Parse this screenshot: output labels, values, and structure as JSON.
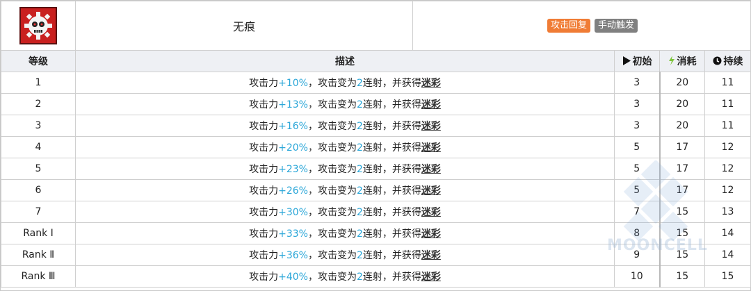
{
  "skill": {
    "name": "无痕",
    "icon": "skull-cog-icon",
    "tags": [
      {
        "label": "攻击回复",
        "color": "#f07c35"
      },
      {
        "label": "手动触发",
        "color": "#808080"
      }
    ]
  },
  "columns": {
    "level": "等级",
    "desc": "描述",
    "init": "初始",
    "cost": "消耗",
    "duration": "持续"
  },
  "desc_parts": {
    "prefix": "攻击力",
    "mid": "，攻击变为",
    "count": "2",
    "suffix": "连射，并获得",
    "keyword": "迷彩"
  },
  "rows": [
    {
      "level": "1",
      "bonus": "+10%",
      "init": "3",
      "cost": "20",
      "duration": "11"
    },
    {
      "level": "2",
      "bonus": "+13%",
      "init": "3",
      "cost": "20",
      "duration": "11"
    },
    {
      "level": "3",
      "bonus": "+16%",
      "init": "3",
      "cost": "20",
      "duration": "11"
    },
    {
      "level": "4",
      "bonus": "+20%",
      "init": "5",
      "cost": "17",
      "duration": "12"
    },
    {
      "level": "5",
      "bonus": "+23%",
      "init": "5",
      "cost": "17",
      "duration": "12"
    },
    {
      "level": "6",
      "bonus": "+26%",
      "init": "5",
      "cost": "17",
      "duration": "12"
    },
    {
      "level": "7",
      "bonus": "+30%",
      "init": "7",
      "cost": "15",
      "duration": "13"
    },
    {
      "level": "Rank Ⅰ",
      "bonus": "+33%",
      "init": "8",
      "cost": "15",
      "duration": "14"
    },
    {
      "level": "Rank Ⅱ",
      "bonus": "+36%",
      "init": "9",
      "cost": "15",
      "duration": "14"
    },
    {
      "level": "Rank Ⅲ",
      "bonus": "+40%",
      "init": "10",
      "cost": "15",
      "duration": "15"
    }
  ],
  "watermark": "MOONCELL",
  "colors": {
    "highlight": "#2aa6d8",
    "header_bg": "#eef0f4"
  }
}
